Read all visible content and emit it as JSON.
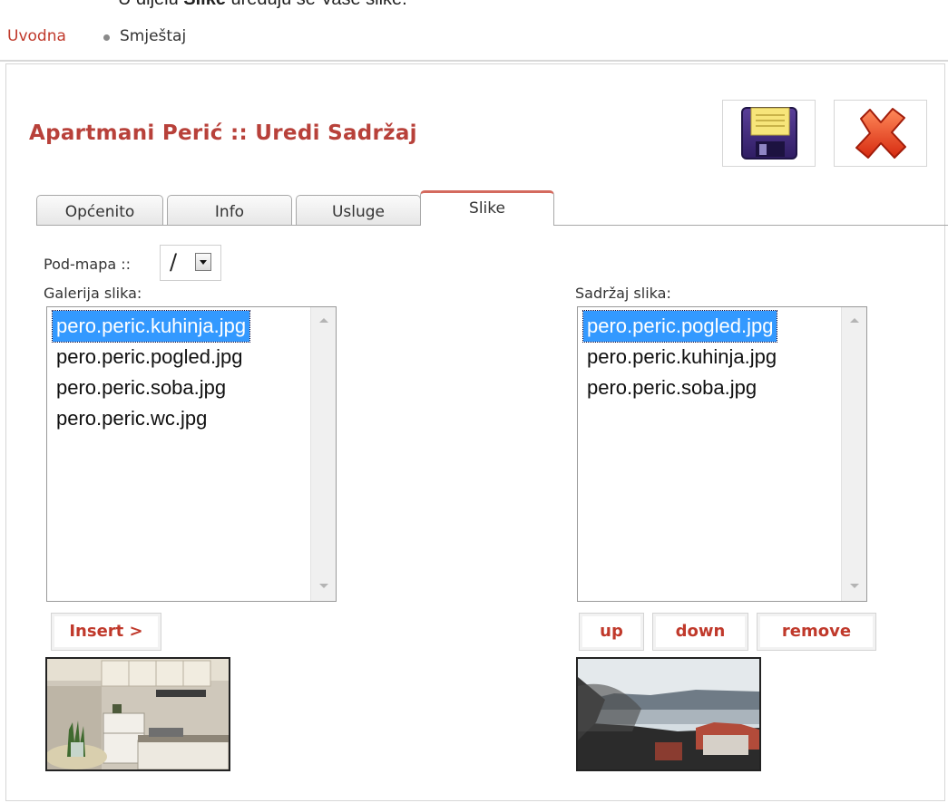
{
  "caption": {
    "prefix": "U dijelu ",
    "bold": "Slike",
    "suffix": " uređuju se Vaše slike."
  },
  "breadcrumb": {
    "home": "Uvodna",
    "current": "Smještaj"
  },
  "page": {
    "title": "Apartmani Perić :: Uredi Sadržaj"
  },
  "toolbar": {
    "save_icon": "floppy-disk-icon",
    "cancel_icon": "red-x-icon"
  },
  "tabs": [
    {
      "label": "Općenito",
      "active": false
    },
    {
      "label": "Info",
      "active": false
    },
    {
      "label": "Usluge",
      "active": false
    },
    {
      "label": "Slike",
      "active": true
    }
  ],
  "subfolder": {
    "label": "Pod-mapa ::",
    "value": "/"
  },
  "gallery": {
    "label": "Galerija slika:",
    "items": [
      "pero.peric.kuhinja.jpg",
      "pero.peric.pogled.jpg",
      "pero.peric.soba.jpg",
      "pero.peric.wc.jpg"
    ],
    "selected_index": 0,
    "insert_label": "Insert >"
  },
  "content": {
    "label": "Sadržaj slika:",
    "items": [
      "pero.peric.pogled.jpg",
      "pero.peric.kuhinja.jpg",
      "pero.peric.soba.jpg"
    ],
    "selected_index": 0,
    "up_label": "up",
    "down_label": "down",
    "remove_label": "remove"
  },
  "colors": {
    "accent": "#c0392b",
    "title": "#b8413a",
    "selection": "#3399ff"
  }
}
